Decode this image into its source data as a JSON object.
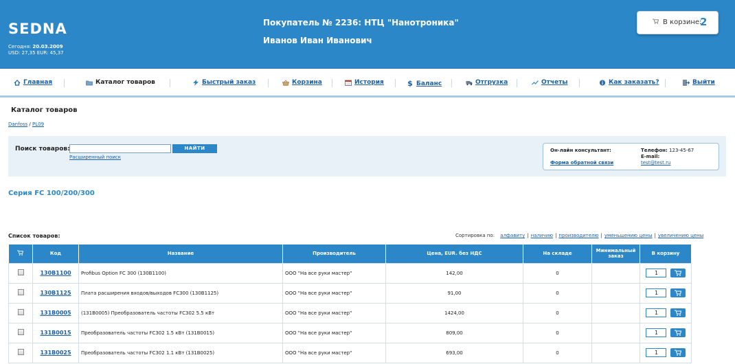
{
  "header": {
    "logo": "SEDNA",
    "today_label": "Сегодня:",
    "today_date": "20.03.2009",
    "rates": "USD: 27,35 EUR: 45,37",
    "buyer": "Покупатель № 2236: НТЦ \"Нанотроника\"",
    "person": "Иванов Иван Иванович",
    "cart_label": "В корзине:",
    "cart_count": "2"
  },
  "nav": {
    "items": [
      {
        "label": "Главная",
        "icon": "home-icon"
      },
      {
        "label": "Каталог товаров",
        "icon": "folder-icon"
      },
      {
        "label": "Быстрый заказ",
        "icon": "lightning-icon"
      },
      {
        "label": "Корзина",
        "icon": "basket-icon"
      },
      {
        "label": "История",
        "icon": "calendar-icon"
      },
      {
        "label": "Баланс",
        "icon": "dollar-icon"
      },
      {
        "label": "Отгрузка",
        "icon": "truck-icon"
      },
      {
        "label": "Отчеты",
        "icon": "chart-icon"
      },
      {
        "label": "Как заказать?",
        "icon": "info-icon"
      },
      {
        "label": "Выйти",
        "icon": "exit-icon"
      }
    ]
  },
  "page": {
    "title": "Каталог товаров",
    "breadcrumb": [
      "Danfoss",
      "PL09"
    ],
    "breadcrumb_sep": "/",
    "series": "Серия FC 100/200/300"
  },
  "search": {
    "label": "Поиск товаров:",
    "value": "",
    "button": "НАЙТИ",
    "advanced": "Расширенный поиск"
  },
  "consultant": {
    "title": "Он-лайн консультант:",
    "feedback": "Форма обратной связи",
    "phone_label": "Телефон:",
    "phone": "123-45-67",
    "email_label": "E-mail:",
    "email": "test@test.ru"
  },
  "list": {
    "title": "Список товаров:",
    "sort_label": "Сортировка по:",
    "sort_options": [
      "алфавиту",
      "наличию",
      "производителю",
      "уменьшению цены",
      "увеличению цены"
    ],
    "columns": [
      "Код",
      "Название",
      "Производитель",
      "Цена, EUR. без НДС",
      "На складе",
      "Минимальный заказ",
      "В корзину"
    ],
    "rows": [
      {
        "code": "130B1100",
        "name": "Profibus Option FC 300 (130B1100)",
        "maker": "ООО \"На все руки мастер\"",
        "price": "142,00",
        "stock": "0",
        "min": "",
        "qty": "1"
      },
      {
        "code": "130B1125",
        "name": "Плата расширения входов/выходов FC300 (130B1125)",
        "maker": "ООО \"На все руки мастер\"",
        "price": "91,00",
        "stock": "0",
        "min": "",
        "qty": "1"
      },
      {
        "code": "131B0005",
        "name": "(131B0005) Преобразователь частоты FC302 5.5 кВт",
        "maker": "ООО \"На все руки мастер\"",
        "price": "1424,00",
        "stock": "0",
        "min": "",
        "qty": "1"
      },
      {
        "code": "131B0015",
        "name": "Преобразователь частоты FC302 1.5 кВт (131B0015)",
        "maker": "ООО \"На все руки мастер\"",
        "price": "809,00",
        "stock": "0",
        "min": "",
        "qty": "1"
      },
      {
        "code": "131B0025",
        "name": "Преобразователь частоты FC302 1.1 кВт (131B0025)",
        "maker": "ООО \"На все руки мастер\"",
        "price": "693,00",
        "stock": "0",
        "min": "",
        "qty": "1"
      }
    ]
  },
  "colors": {
    "header_bg": "#2b87c7",
    "link": "#1a5fa8",
    "panel_bg": "#e8f1f8"
  }
}
